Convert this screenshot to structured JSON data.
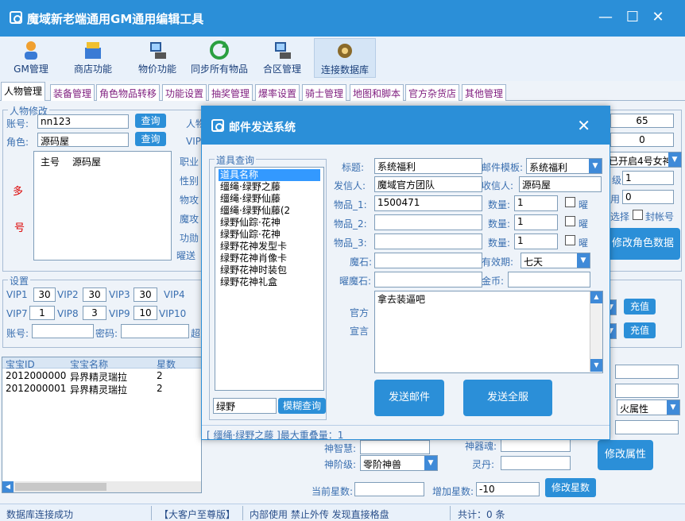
{
  "window": {
    "title": "魔域新老端通用GM通用编辑工具"
  },
  "toolbar": {
    "items": [
      {
        "label": "GM管理",
        "icon": "user-icon"
      },
      {
        "label": "商店功能",
        "icon": "shop-icon"
      },
      {
        "label": "物价功能",
        "icon": "computer-icon"
      },
      {
        "label": "同步所有物品",
        "icon": "sync-icon"
      },
      {
        "label": "合区管理",
        "icon": "computer-icon"
      },
      {
        "label": "连接数据库",
        "icon": "database-icon"
      }
    ]
  },
  "tabs": [
    "人物管理",
    "装备管理",
    "角色物品转移",
    "功能设置",
    "抽奖管理",
    "爆率设置",
    "骑士管理",
    "地图和脚本",
    "官方杂货店",
    "其他管理"
  ],
  "char_edit": {
    "legend": "人物修改",
    "account_label": "账号:",
    "account_value": "nn123",
    "role_label": "角色:",
    "role_value": "源码屋",
    "query_label": "查询",
    "list_headers": [
      "主号",
      "源码屋"
    ],
    "side_labels": [
      "人物",
      "VIP",
      "职业",
      "性别",
      "物攻",
      "魔攻",
      "功勋",
      "曜送"
    ],
    "red_labels": [
      "多",
      "号"
    ],
    "right_values": [
      "65",
      "0",
      "1",
      "0"
    ],
    "right_dropdown": "已开启4号女神",
    "right_labels": [
      "级",
      "用",
      "选择"
    ],
    "ban_label": "封帐号",
    "modify_button": "修改角色数据"
  },
  "settings": {
    "legend": "设置",
    "vip_rows": [
      [
        {
          "label": "VIP1",
          "value": "30"
        },
        {
          "label": "VIP2",
          "value": "30"
        },
        {
          "label": "VIP3",
          "value": "30"
        },
        {
          "label": "VIP4",
          "value": ""
        }
      ],
      [
        {
          "label": "VIP7",
          "value": "1"
        },
        {
          "label": "VIP8",
          "value": "3"
        },
        {
          "label": "VIP9",
          "value": "10"
        },
        {
          "label": "VIP10",
          "value": ""
        }
      ]
    ],
    "account_label": "账号:",
    "password_label": "密码:",
    "super_label": "超",
    "recharge_button": "充值"
  },
  "pet_table": {
    "headers": [
      "宝宝ID",
      "宝宝名称",
      "星数"
    ],
    "rows": [
      [
        "2012000000",
        "异界精灵瑞拉",
        "2"
      ],
      [
        "2012000001",
        "异界精灵瑞拉",
        "2"
      ]
    ],
    "fire_attr": "火属性",
    "modify_attr_button": "修改属性",
    "god_wisdom_label": "神智慧:",
    "god_soul_label": "神器魂:",
    "god_stage_label": "神阶级:",
    "god_stage_value": "零阶神兽",
    "spirit_pill_label": "灵丹:",
    "current_star_label": "当前星数:",
    "add_star_label": "增加星数:",
    "add_star_value": "-10",
    "modify_star_button": "修改星数"
  },
  "dialog": {
    "title": "邮件发送系统",
    "item_query_legend": "道具查询",
    "item_list": [
      "道具名称",
      "缰绳·绿野之藤",
      "缰绳·绿野仙藤",
      "缰绳·绿野仙藤(2",
      "绿野仙踪·花神",
      "绿野仙踪·花神",
      "绿野花神发型卡",
      "绿野花神肖像卡",
      "绿野花神时装包",
      "绿野花神礼盒"
    ],
    "search_value": "绿野",
    "fuzzy_button": "模糊查询",
    "subject_label": "标题:",
    "subject_value": "系统福利",
    "template_label": "邮件模板:",
    "template_value": "系统福利",
    "sender_label": "发信人:",
    "sender_value": "魔域官方团队",
    "receiver_label": "收信人:",
    "receiver_value": "源码屋",
    "item1_label": "物品_1:",
    "item1_value": "1500471",
    "item2_label": "物品_2:",
    "item3_label": "物品_3:",
    "qty_label": "数量:",
    "qty_values": [
      "1",
      "1",
      "1"
    ],
    "bind_label": "曜",
    "magic_stone_label": "魔石:",
    "validity_label": "有效期:",
    "validity_value": "七天",
    "yao_stone_label": "曜魔石:",
    "gold_label": "金币:",
    "official_label": "官方",
    "declaration_label": "宣言",
    "message_value": "拿去装逼吧",
    "send_mail_button": "发送邮件",
    "send_all_button": "发送全服",
    "status_text": "[ 缰绳·绿野之藤 ]最大重叠量：1"
  },
  "statusbar": {
    "connection": "数据库连接成功",
    "edition": "【大客户至尊版】",
    "notice": "内部使用 禁止外传 发现直接格盘",
    "total": "共计：0 条"
  }
}
